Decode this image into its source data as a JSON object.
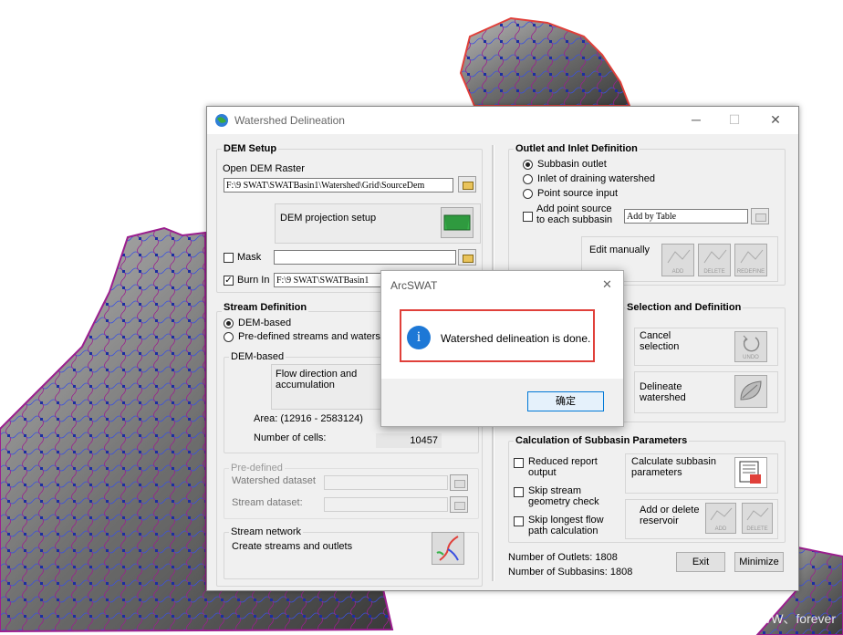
{
  "window": {
    "title": "Watershed Delineation",
    "minimize_glyph": "─",
    "maximize_glyph": "☐",
    "close_glyph": "✕"
  },
  "dem_setup": {
    "title": "DEM Setup",
    "open_label": "Open DEM Raster",
    "dem_path": "F:\\9 SWAT\\SWATBasin1\\Watershed\\Grid\\SourceDem",
    "projection_label": "DEM projection setup",
    "mask_label": "Mask",
    "burn_label": "Burn In",
    "burn_path": "F:\\9 SWAT\\SWATBasin1"
  },
  "stream_def": {
    "title": "Stream Definition",
    "opt_dem": "DEM-based",
    "opt_predef": "Pre-defined streams and waters",
    "dem_group": "DEM-based",
    "flow_label": "Flow direction and accumulation",
    "area_label": "Area: (12916 - 2583124)",
    "cells_label": "Number of cells:",
    "cells_value": "10457"
  },
  "predefined": {
    "title": "Pre-defined",
    "ws_label": "Watershed dataset",
    "stream_label": "Stream dataset:"
  },
  "stream_network": {
    "title": "Stream network",
    "label": "Create streams and outlets"
  },
  "outlet": {
    "title": "Outlet and Inlet Definition",
    "opt1": "Subbasin outlet",
    "opt2": "Inlet of draining watershed",
    "opt3": "Point source input",
    "add_point_label": "Add point source to each subbasin",
    "add_by_table": "Add by Table",
    "edit_label": "Edit manually",
    "add": "ADD",
    "delete": "DELETE",
    "redefine": "REDEFINE"
  },
  "selection": {
    "title": "Selection and Definition",
    "cancel_label": "Cancel selection",
    "undo": "UNDO",
    "delineate_label": "Delineate watershed"
  },
  "calc": {
    "title": "Calculation of Subbasin Parameters",
    "reduced": "Reduced report output",
    "skip_geom": "Skip stream geometry check",
    "skip_long": "Skip longest flow path calculation",
    "calc_label": "Calculate subbasin parameters",
    "addres_label": "Add or delete reservoir",
    "add": "ADD",
    "delete": "DELETE"
  },
  "footer": {
    "outlets": "Number of Outlets: 1808",
    "subbasins": "Number of Subbasins: 1808",
    "exit": "Exit",
    "minimize": "Minimize"
  },
  "dialog": {
    "title": "ArcSWAT",
    "message": "Watershed delineation is done.",
    "ok": "确定",
    "info_glyph": "i",
    "close_glyph": "✕"
  },
  "watermark": "CSDN @WW、forever",
  "colors": {
    "highlight": "#e0403a",
    "info": "#1d78d6",
    "stream": "#3a50e0",
    "boundary": "#9b1e8e"
  }
}
